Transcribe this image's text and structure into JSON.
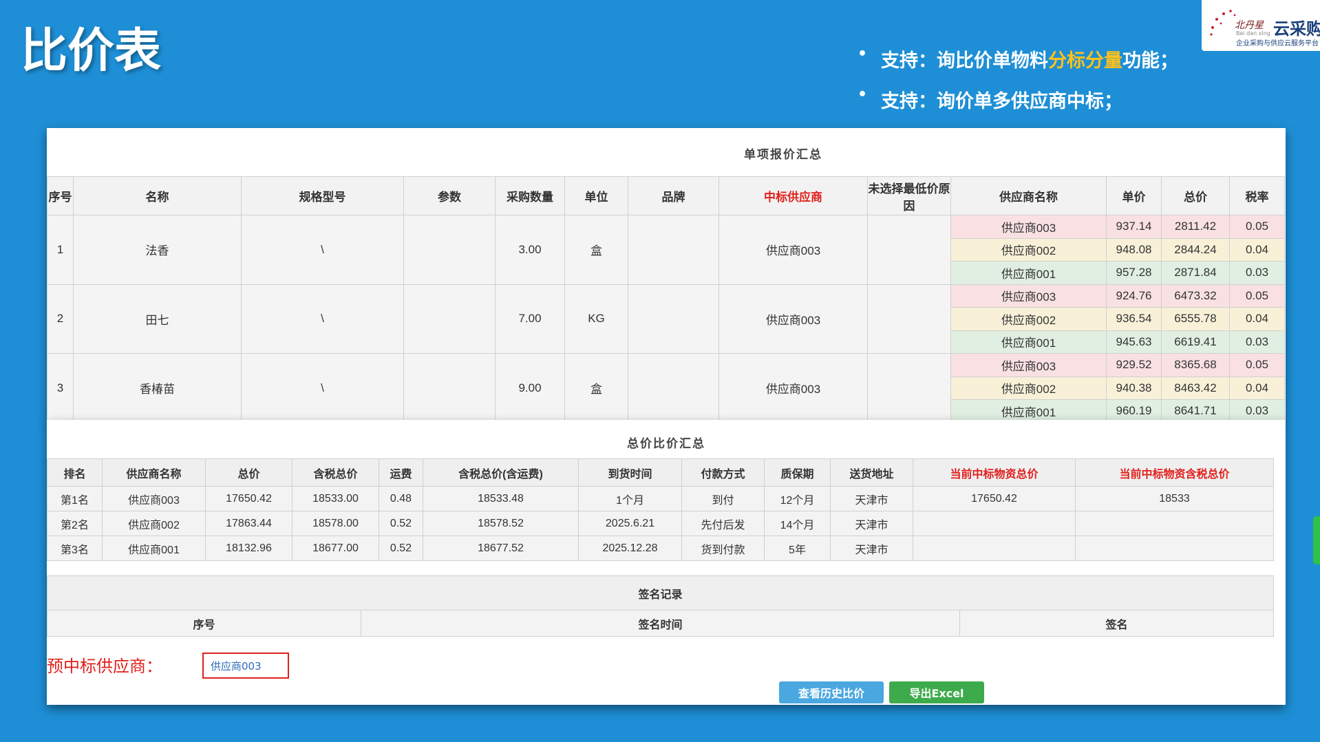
{
  "slide": {
    "title": "比价表",
    "bullet1_pre": "支持：询比价单物料",
    "bullet1_hl": "分标分量",
    "bullet1_post": "功能；",
    "bullet2": "支持：询价单多供应商中标；"
  },
  "logo": {
    "script": "北丹星",
    "sub": "Bei dan xing",
    "name": "云采购",
    "tagline": "企业采购与供应云服务平台"
  },
  "item_summary": {
    "title": "单项报价汇总",
    "headers": [
      "序号",
      "名称",
      "规格型号",
      "参数",
      "采购数量",
      "单位",
      "品牌",
      "中标供应商",
      "未选择最低价原因",
      "供应商名称",
      "单价",
      "总价",
      "税率"
    ],
    "items": [
      {
        "no": "1",
        "name": "法香",
        "spec": "\\",
        "param": "",
        "qty": "3.00",
        "unit": "盒",
        "brand": "",
        "winner": "供应商003",
        "reason": "",
        "quotes": [
          {
            "supplier": "供应商003",
            "price": "937.14",
            "total": "2811.42",
            "tax": "0.05"
          },
          {
            "supplier": "供应商002",
            "price": "948.08",
            "total": "2844.24",
            "tax": "0.04"
          },
          {
            "supplier": "供应商001",
            "price": "957.28",
            "total": "2871.84",
            "tax": "0.03"
          }
        ]
      },
      {
        "no": "2",
        "name": "田七",
        "spec": "\\",
        "param": "",
        "qty": "7.00",
        "unit": "KG",
        "brand": "",
        "winner": "供应商003",
        "reason": "",
        "quotes": [
          {
            "supplier": "供应商003",
            "price": "924.76",
            "total": "6473.32",
            "tax": "0.05"
          },
          {
            "supplier": "供应商002",
            "price": "936.54",
            "total": "6555.78",
            "tax": "0.04"
          },
          {
            "supplier": "供应商001",
            "price": "945.63",
            "total": "6619.41",
            "tax": "0.03"
          }
        ]
      },
      {
        "no": "3",
        "name": "香椿苗",
        "spec": "\\",
        "param": "",
        "qty": "9.00",
        "unit": "盒",
        "brand": "",
        "winner": "供应商003",
        "reason": "",
        "quotes": [
          {
            "supplier": "供应商003",
            "price": "929.52",
            "total": "8365.68",
            "tax": "0.05"
          },
          {
            "supplier": "供应商002",
            "price": "940.38",
            "total": "8463.42",
            "tax": "0.04"
          },
          {
            "supplier": "供应商001",
            "price": "960.19",
            "total": "8641.71",
            "tax": "0.03"
          }
        ]
      }
    ]
  },
  "total_summary": {
    "title": "总价比价汇总",
    "headers": [
      "排名",
      "供应商名称",
      "总价",
      "含税总价",
      "运费",
      "含税总价(含运费)",
      "到货时间",
      "付款方式",
      "质保期",
      "送货地址",
      "当前中标物资总价",
      "当前中标物资含税总价"
    ],
    "rows": [
      [
        "第1名",
        "供应商003",
        "17650.42",
        "18533.00",
        "0.48",
        "18533.48",
        "1个月",
        "到付",
        "12个月",
        "天津市",
        "17650.42",
        "18533"
      ],
      [
        "第2名",
        "供应商002",
        "17863.44",
        "18578.00",
        "0.52",
        "18578.52",
        "2025.6.21",
        "先付后发",
        "14个月",
        "天津市",
        "",
        ""
      ],
      [
        "第3名",
        "供应商001",
        "18132.96",
        "18677.00",
        "0.52",
        "18677.52",
        "2025.12.28",
        "货到付款",
        "5年",
        "天津市",
        "",
        ""
      ]
    ]
  },
  "signature": {
    "title": "签名记录",
    "headers": [
      "序号",
      "签名时间",
      "签名"
    ]
  },
  "pre_winner": {
    "label": "预中标供应商：",
    "value": "供应商003"
  },
  "buttons": {
    "history": "查看历史比价",
    "export": "导出Excel"
  }
}
